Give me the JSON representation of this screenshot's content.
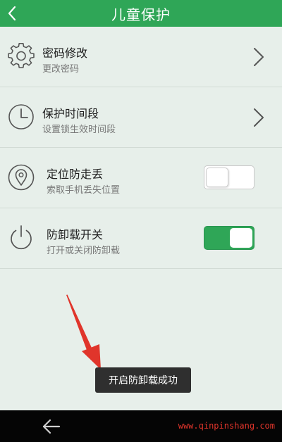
{
  "header": {
    "title": "儿童保护"
  },
  "settings": [
    {
      "title": "密码修改",
      "subtitle": "更改密码",
      "icon": "gear-icon",
      "control": "chevron"
    },
    {
      "title": "保护时间段",
      "subtitle": "设置锁生效时间段",
      "icon": "clock-icon",
      "control": "chevron"
    },
    {
      "title": "定位防走丢",
      "subtitle": "索取手机丢失位置",
      "icon": "location-pin-icon",
      "control": "toggle",
      "toggle_on": false
    },
    {
      "title": "防卸载开关",
      "subtitle": "打开或关闭防卸载",
      "icon": "power-icon",
      "control": "toggle",
      "toggle_on": true
    }
  ],
  "toast": {
    "message": "开启防卸载成功"
  },
  "navbar": {
    "back_icon": "back-arrow-icon",
    "watermark": "www.qinpinshang.com"
  },
  "colors": {
    "brand_green": "#2fa657",
    "background": "#e7efea",
    "annotation_red": "#e0352b",
    "toast_bg": "#2f2f2f"
  }
}
